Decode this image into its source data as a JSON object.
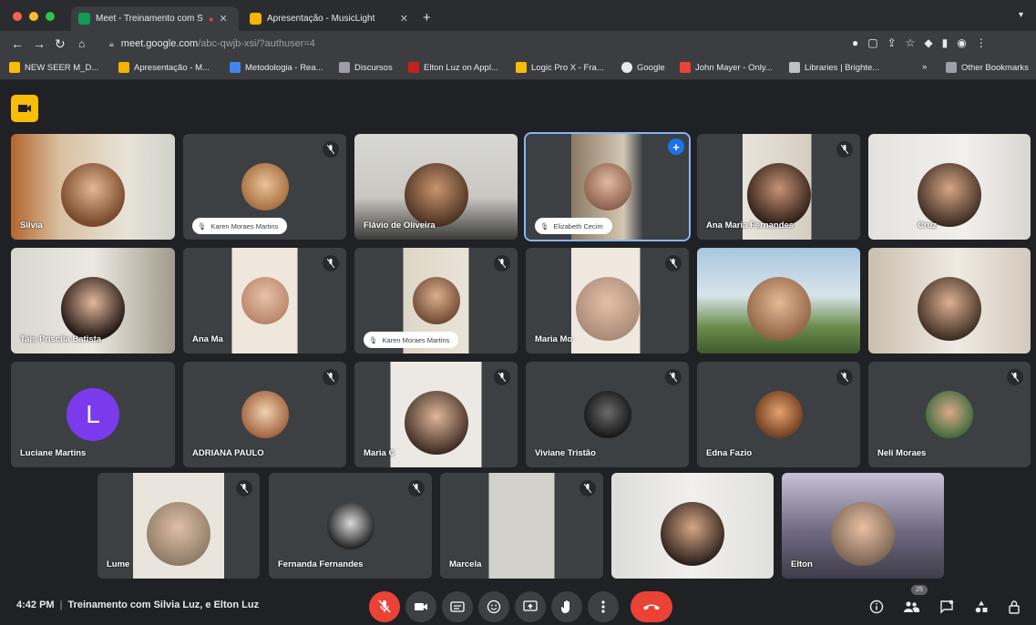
{
  "colors": {
    "meet_yellow": "#fbbc04",
    "end_red": "#ea4335",
    "mute_red": "#ea4335",
    "pin_blue": "#1a73e8",
    "avatar_purple": "#7c3aed"
  },
  "tabs": [
    {
      "title": "Meet - Treinamento com S",
      "favicon": "google-meet-icon",
      "active": true
    },
    {
      "title": "Apresentação - MusicLight",
      "favicon": "slides-icon",
      "active": false
    }
  ],
  "address_bar": {
    "host": "meet.google.com",
    "path": "/abc-qwjb-xsi/?authuser=4"
  },
  "bookmarks": [
    {
      "label": "NEW SEER M_D...",
      "icon": "folder-icon"
    },
    {
      "label": "Apresentação - M...",
      "icon": "slides-icon"
    },
    {
      "label": "Metodologia - Rea...",
      "icon": "docs-icon"
    },
    {
      "label": "Discursos",
      "icon": "folder-icon"
    },
    {
      "label": "Elton Luz on Appl...",
      "icon": "podcast-icon"
    },
    {
      "label": "Logic Pro X - Fra...",
      "icon": "bookmark-icon"
    },
    {
      "label": "Google",
      "icon": "google-icon"
    },
    {
      "label": "John Mayer - Only...",
      "icon": "youtube-icon"
    },
    {
      "label": "Libraries | Brighte...",
      "icon": "library-icon"
    }
  ],
  "other_bookmarks": "Other Bookmarks",
  "participants": [
    {
      "name": "Silvia",
      "muted": false,
      "pinned": false,
      "video": true,
      "notice": ""
    },
    {
      "name": "",
      "muted": true,
      "pinned": false,
      "video": false,
      "notice": "Karen Moraes Martins"
    },
    {
      "name": "Flávio de Oliveira",
      "muted": false,
      "pinned": false,
      "video": true,
      "notice": ""
    },
    {
      "name": "",
      "muted": false,
      "pinned": true,
      "video": true,
      "notice": "Elizabeth Cecim"
    },
    {
      "name": "Ana Maria Fernandes",
      "muted": true,
      "pinned": false,
      "video": true,
      "notice": ""
    },
    {
      "name": "Cruz",
      "muted": false,
      "pinned": false,
      "video": true,
      "notice": ""
    },
    {
      "name": "Tais Priscila Batista",
      "muted": false,
      "pinned": false,
      "video": true,
      "notice": ""
    },
    {
      "name": "Ana Ma",
      "muted": true,
      "pinned": false,
      "video": true,
      "notice": ""
    },
    {
      "name": "",
      "muted": true,
      "pinned": false,
      "video": true,
      "notice": "Karen Moraes Martins"
    },
    {
      "name": "Maria Mo",
      "muted": true,
      "pinned": false,
      "video": true,
      "notice": ""
    },
    {
      "name": "",
      "muted": false,
      "pinned": false,
      "video": true,
      "notice": ""
    },
    {
      "name": "",
      "muted": false,
      "pinned": false,
      "video": true,
      "notice": ""
    },
    {
      "name": "Luciane Martins",
      "muted": false,
      "pinned": false,
      "video": false,
      "avatar_letter": "L",
      "notice": ""
    },
    {
      "name": "ADRIANA PAULO",
      "muted": true,
      "pinned": false,
      "video": false,
      "notice": ""
    },
    {
      "name": "Maria C",
      "muted": true,
      "pinned": false,
      "video": true,
      "notice": ""
    },
    {
      "name": "Viviane Tristão",
      "muted": true,
      "pinned": false,
      "video": false,
      "notice": ""
    },
    {
      "name": "Edna Fazio",
      "muted": true,
      "pinned": false,
      "video": false,
      "notice": ""
    },
    {
      "name": "Neli Moraes",
      "muted": true,
      "pinned": false,
      "video": false,
      "notice": ""
    },
    {
      "name": "Lume",
      "muted": true,
      "pinned": false,
      "video": true,
      "notice": ""
    },
    {
      "name": "Fernanda Fernandes",
      "muted": true,
      "pinned": false,
      "video": false,
      "notice": ""
    },
    {
      "name": "Marcela",
      "muted": true,
      "pinned": false,
      "video": true,
      "notice": ""
    },
    {
      "name": "",
      "muted": false,
      "pinned": false,
      "video": true,
      "notice": ""
    },
    {
      "name": "Elton",
      "muted": false,
      "pinned": false,
      "video": true,
      "notice": ""
    }
  ],
  "bottom_bar": {
    "time": "4:42 PM",
    "meeting_title": "Treinamento com Silvia Luz, e Elton Luz",
    "controls": [
      "mic-off-icon",
      "camera-icon",
      "captions-icon",
      "emoji-icon",
      "present-icon",
      "raise-hand-icon",
      "more-options-icon",
      "end-call-icon"
    ],
    "right_controls": [
      "info-icon",
      "people-icon",
      "chat-icon",
      "activities-icon",
      "host-controls-icon"
    ],
    "participant_count": "25"
  }
}
